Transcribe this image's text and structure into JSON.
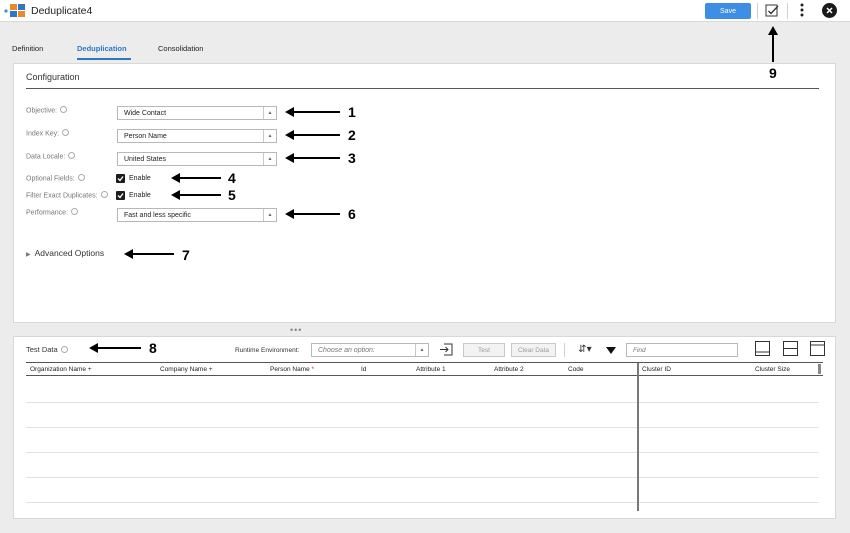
{
  "app": {
    "title": "Deduplicate4"
  },
  "toolbar": {
    "save_label": "Save",
    "validate_icon": "validate-check-icon",
    "more_icon": "kebab-menu-icon",
    "close_icon": "close-circle-icon"
  },
  "tabs": [
    {
      "label": "Definition",
      "active": false
    },
    {
      "label": "Deduplication",
      "active": true
    },
    {
      "label": "Consolidation",
      "active": false
    }
  ],
  "configuration": {
    "heading": "Configuration",
    "objective": {
      "label": "Objective:",
      "value": "Wide Contact"
    },
    "index_key": {
      "label": "Index Key:",
      "value": "Person Name"
    },
    "data_locale": {
      "label": "Data Locale:",
      "value": "United States"
    },
    "optional_fields": {
      "label": "Optional Fields:",
      "checkbox_label": "Enable",
      "checked": true
    },
    "filter_exact_duplicates": {
      "label": "Filter Exact Duplicates:",
      "checkbox_label": "Enable",
      "checked": true
    },
    "performance": {
      "label": "Performance:",
      "value": "Fast and less specific"
    },
    "advanced_options": "Advanced Options"
  },
  "test_data": {
    "title": "Test Data",
    "runtime_label": "Runtime Environment:",
    "runtime_placeholder": "Choose an option:",
    "test_button": "Test",
    "clear_button": "Clear Data",
    "find_placeholder": "Find",
    "columns": [
      {
        "label": "Organization Name",
        "suffix": " +"
      },
      {
        "label": "Company Name",
        "suffix": " +"
      },
      {
        "label": "Person Name",
        "suffix": " *"
      },
      {
        "label": "Id",
        "suffix": ""
      },
      {
        "label": "Attribute 1",
        "suffix": ""
      },
      {
        "label": "Attribute 2",
        "suffix": ""
      },
      {
        "label": "Code",
        "suffix": ""
      },
      {
        "label": "Cluster ID",
        "suffix": ""
      },
      {
        "label": "Cluster Size",
        "suffix": ""
      }
    ]
  },
  "annotations": [
    "1",
    "2",
    "3",
    "4",
    "5",
    "6",
    "7",
    "8",
    "9"
  ],
  "colors": {
    "accent": "#2f77c5",
    "save": "#3d8ee4"
  }
}
